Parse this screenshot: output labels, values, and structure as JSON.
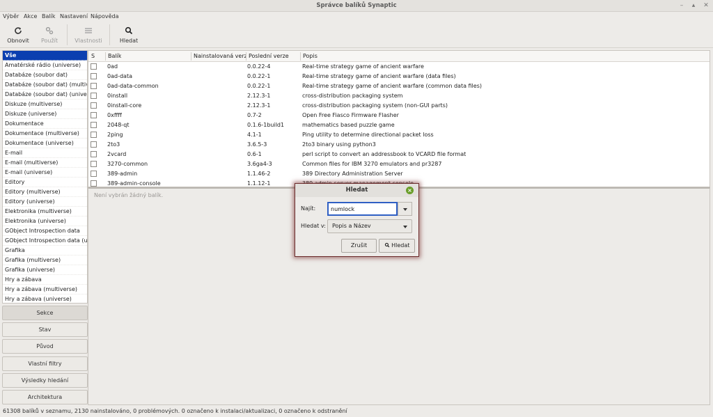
{
  "window": {
    "title": "Správce balíků Synaptic"
  },
  "menu": [
    "Výběr",
    "Akce",
    "Balík",
    "Nastavení",
    "Nápověda"
  ],
  "toolbar": {
    "reload": "Obnovit",
    "apply": "Použít",
    "properties": "Vlastnosti",
    "search": "Hledat"
  },
  "sections": [
    "Vše",
    "Amatérské rádio (universe)",
    "Databáze (soubor dat)",
    "Databáze (soubor dat) (multiverse)",
    "Databáze (soubor dat) (universe)",
    "Diskuze (multiverse)",
    "Diskuze (universe)",
    "Dokumentace",
    "Dokumentace (multiverse)",
    "Dokumentace (universe)",
    "E-mail",
    "E-mail (multiverse)",
    "E-mail (universe)",
    "Editory",
    "Editory (multiverse)",
    "Editory (universe)",
    "Elektronika (multiverse)",
    "Elektronika (universe)",
    "GObject Introspection data",
    "GObject Introspection data (universe)",
    "Grafika",
    "Grafika (multiverse)",
    "Grafika (universe)",
    "Hry a zábava",
    "Hry a zábava (multiverse)",
    "Hry a zábava (universe)"
  ],
  "filters": [
    "Sekce",
    "Stav",
    "Původ",
    "Vlastní filtry",
    "Výsledky hledání",
    "Architektura"
  ],
  "columns": {
    "s": "S",
    "package": "Balík",
    "installed": "Nainstalovaná verze",
    "latest": "Poslední verze",
    "desc": "Popis"
  },
  "packages": [
    {
      "name": "0ad",
      "installed": "",
      "latest": "0.0.22-4",
      "desc": "Real-time strategy game of ancient warfare"
    },
    {
      "name": "0ad-data",
      "installed": "",
      "latest": "0.0.22-1",
      "desc": "Real-time strategy game of ancient warfare (data files)"
    },
    {
      "name": "0ad-data-common",
      "installed": "",
      "latest": "0.0.22-1",
      "desc": "Real-time strategy game of ancient warfare (common data files)"
    },
    {
      "name": "0install",
      "installed": "",
      "latest": "2.12.3-1",
      "desc": "cross-distribution packaging system"
    },
    {
      "name": "0install-core",
      "installed": "",
      "latest": "2.12.3-1",
      "desc": "cross-distribution packaging system (non-GUI parts)"
    },
    {
      "name": "0xffff",
      "installed": "",
      "latest": "0.7-2",
      "desc": "Open Free Fiasco Firmware Flasher"
    },
    {
      "name": "2048-qt",
      "installed": "",
      "latest": "0.1.6-1build1",
      "desc": "mathematics based puzzle game"
    },
    {
      "name": "2ping",
      "installed": "",
      "latest": "4.1-1",
      "desc": "Ping utility to determine directional packet loss"
    },
    {
      "name": "2to3",
      "installed": "",
      "latest": "3.6.5-3",
      "desc": "2to3 binary using python3"
    },
    {
      "name": "2vcard",
      "installed": "",
      "latest": "0.6-1",
      "desc": "perl script to convert an addressbook to VCARD file format"
    },
    {
      "name": "3270-common",
      "installed": "",
      "latest": "3.6ga4-3",
      "desc": "Common files for IBM 3270 emulators and pr3287"
    },
    {
      "name": "389-admin",
      "installed": "",
      "latest": "1.1.46-2",
      "desc": "389 Directory Administration Server"
    },
    {
      "name": "389-admin-console",
      "installed": "",
      "latest": "1.1.12-1",
      "desc": "389 admin server management console"
    }
  ],
  "detail": {
    "message": "Není vybrán žádný balík."
  },
  "status": "61308 balíků v seznamu, 2130 nainstalováno, 0 problémových. 0 označeno k instalaci/aktualizaci, 0 označeno k odstranění",
  "dialog": {
    "title": "Hledat",
    "find_label": "Najít:",
    "find_value": "numlock",
    "search_in_label": "Hledat v:",
    "search_in_value": "Popis a Název",
    "cancel": "Zrušit",
    "search": "Hledat"
  },
  "colors": {
    "selection": "#0b3fb0",
    "focus": "#2f5fc4",
    "close": "#6a9e2a"
  }
}
